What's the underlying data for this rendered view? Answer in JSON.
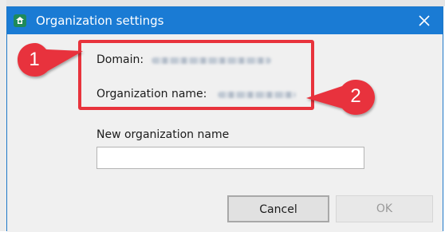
{
  "window": {
    "title": "Organization settings"
  },
  "form": {
    "domain_label": "Domain:",
    "organization_name_label": "Organization name:",
    "new_name_label": "New organization name",
    "new_name_value": ""
  },
  "buttons": {
    "cancel_label": "Cancel",
    "ok_label": "OK"
  },
  "annotations": {
    "callout_1": "1",
    "callout_2": "2",
    "color": "#e8333c"
  },
  "colors": {
    "titlebar": "#1a7bd4",
    "dialog_bg": "#f0f0f0"
  },
  "icons": {
    "app": "organization-settings-icon",
    "close": "close-icon"
  }
}
